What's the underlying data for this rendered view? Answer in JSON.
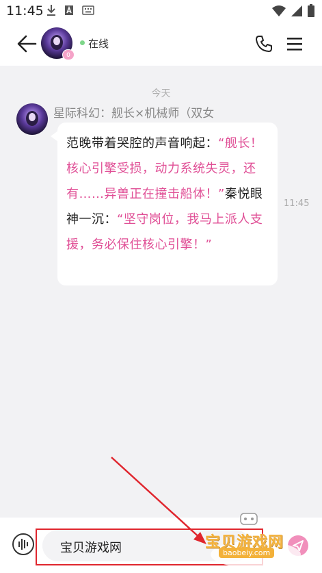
{
  "status_bar": {
    "time": "11:45",
    "left_icons": [
      "download-icon",
      "a-box-icon",
      "keyboard-icon"
    ],
    "right_icons": [
      "wifi-icon",
      "signal-icon",
      "battery-icon"
    ]
  },
  "header": {
    "status_text": "在线",
    "avatar_badge": "0"
  },
  "chat": {
    "date_divider": "今天",
    "message": {
      "sender": "星际科幻：舰长×机械师（双女",
      "time": "11:45",
      "segments": [
        {
          "type": "narration",
          "text": "范晚带着哭腔的声音响起："
        },
        {
          "type": "speech",
          "text": "“舰长！核心引擎受损，动力系统失灵，还有……异兽正在撞击船体！”"
        },
        {
          "type": "narration",
          "text": "秦悦眼神一沉："
        },
        {
          "type": "speech",
          "text": "“坚守岗位，我马上派人支援，务必保住核心引擎！”"
        }
      ]
    }
  },
  "input_bar": {
    "input_value": "宝贝游戏网"
  },
  "watermark": {
    "title": "宝贝游戏网",
    "url": "baobeiy.com"
  },
  "colors": {
    "accent_pink": "#e04f96",
    "send_button": "#f18fbb",
    "online_green": "#7ed68a",
    "annotation_red": "#e0262e"
  }
}
